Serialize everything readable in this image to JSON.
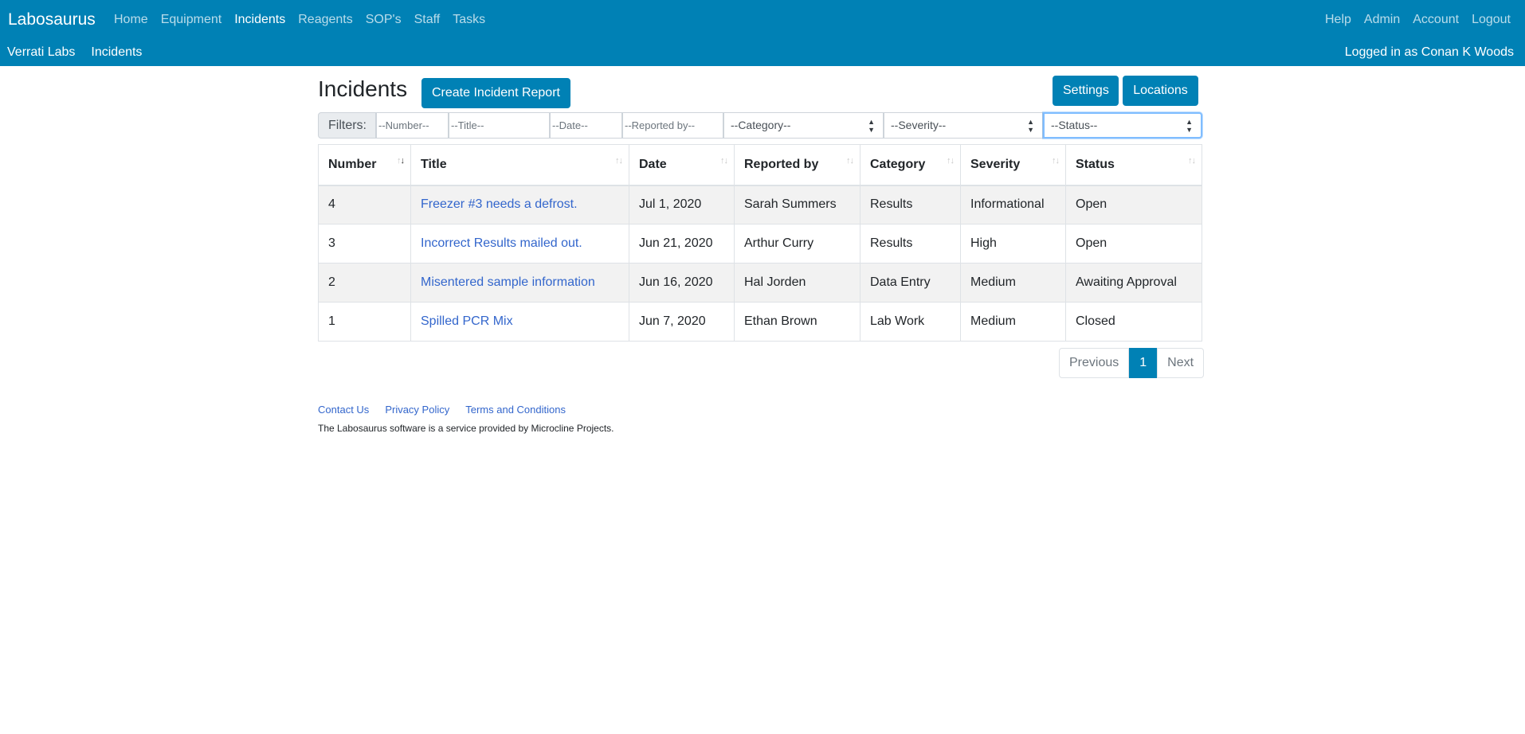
{
  "nav": {
    "brand": "Labosaurus",
    "items": [
      {
        "label": "Home",
        "active": false
      },
      {
        "label": "Equipment",
        "active": false
      },
      {
        "label": "Incidents",
        "active": true
      },
      {
        "label": "Reagents",
        "active": false
      },
      {
        "label": "SOP's",
        "active": false
      },
      {
        "label": "Staff",
        "active": false
      },
      {
        "label": "Tasks",
        "active": false
      }
    ],
    "right": [
      "Help",
      "Admin",
      "Account",
      "Logout"
    ]
  },
  "subnav": {
    "breadcrumb": [
      "Verrati Labs",
      "Incidents"
    ],
    "logged_in": "Logged in as Conan K Woods"
  },
  "page": {
    "title": "Incidents",
    "create_button": "Create Incident Report",
    "settings_button": "Settings",
    "locations_button": "Locations"
  },
  "filters": {
    "label": "Filters:",
    "number_placeholder": "--Number--",
    "title_placeholder": "--Title--",
    "date_placeholder": "--Date--",
    "reported_placeholder": "--Reported by--",
    "category": "--Category--",
    "severity": "--Severity--",
    "status": "--Status--"
  },
  "table": {
    "columns": [
      "Number",
      "Title",
      "Date",
      "Reported by",
      "Category",
      "Severity",
      "Status"
    ],
    "rows": [
      [
        "4",
        "Freezer #3 needs a defrost.",
        "Jul 1, 2020",
        "Sarah Summers",
        "Results",
        "Informational",
        "Open"
      ],
      [
        "3",
        "Incorrect Results mailed out.",
        "Jun 21, 2020",
        "Arthur Curry",
        "Results",
        "High",
        "Open"
      ],
      [
        "2",
        "Misentered sample information",
        "Jun 16, 2020",
        "Hal Jorden",
        "Data Entry",
        "Medium",
        "Awaiting Approval"
      ],
      [
        "1",
        "Spilled PCR Mix",
        "Jun 7, 2020",
        "Ethan Brown",
        "Lab Work",
        "Medium",
        "Closed"
      ]
    ]
  },
  "pagination": {
    "previous": "Previous",
    "current": "1",
    "next": "Next"
  },
  "footer": {
    "links": [
      "Contact Us",
      "Privacy Policy",
      "Terms and Conditions"
    ],
    "note": "The Labosaurus software is a service provided by Microcline Projects."
  },
  "colors": {
    "primary": "#0081b5",
    "link": "#3366cc"
  }
}
